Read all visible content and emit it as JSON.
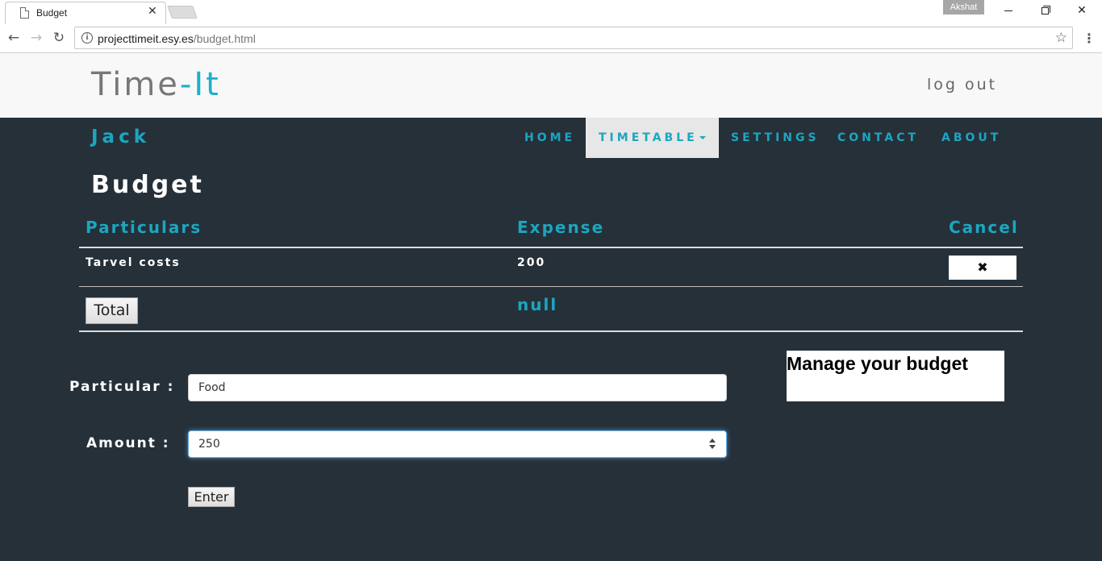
{
  "browser": {
    "tab_title": "Budget",
    "tab_close": "✕",
    "profile_name": "Akshat",
    "url_host": "projecttimeit.esy.es",
    "url_path": "/budget.html",
    "back_icon": "←",
    "forward_icon": "→",
    "reload_icon": "↻",
    "star_icon": "☆",
    "menu_icon": "⋮",
    "close_icon": "✕"
  },
  "header": {
    "logo_main": "Time",
    "logo_accent": "-It",
    "logout_label": "log out"
  },
  "nav": {
    "user_name": "Jack",
    "items": [
      "HOME",
      "TIMETABLE",
      "SETTINGS",
      "CONTACT",
      "ABOUT"
    ]
  },
  "page": {
    "title": "Budget"
  },
  "table": {
    "headers": [
      "Particulars",
      "Expense",
      "Cancel"
    ],
    "rows": [
      {
        "particular": "Tarvel costs",
        "expense": "200",
        "cancel_icon": "✖"
      }
    ],
    "total_label": "Total",
    "total_value": "null"
  },
  "form": {
    "particular_label": "Particular :",
    "particular_value": "Food",
    "amount_label": "Amount :",
    "amount_value": "250",
    "enter_label": "Enter"
  },
  "aside": {
    "manage_text": "Manage your budget"
  },
  "colors": {
    "accent": "#1ba6c0",
    "page_bg": "#263039",
    "header_bg": "#f8f8f8"
  }
}
